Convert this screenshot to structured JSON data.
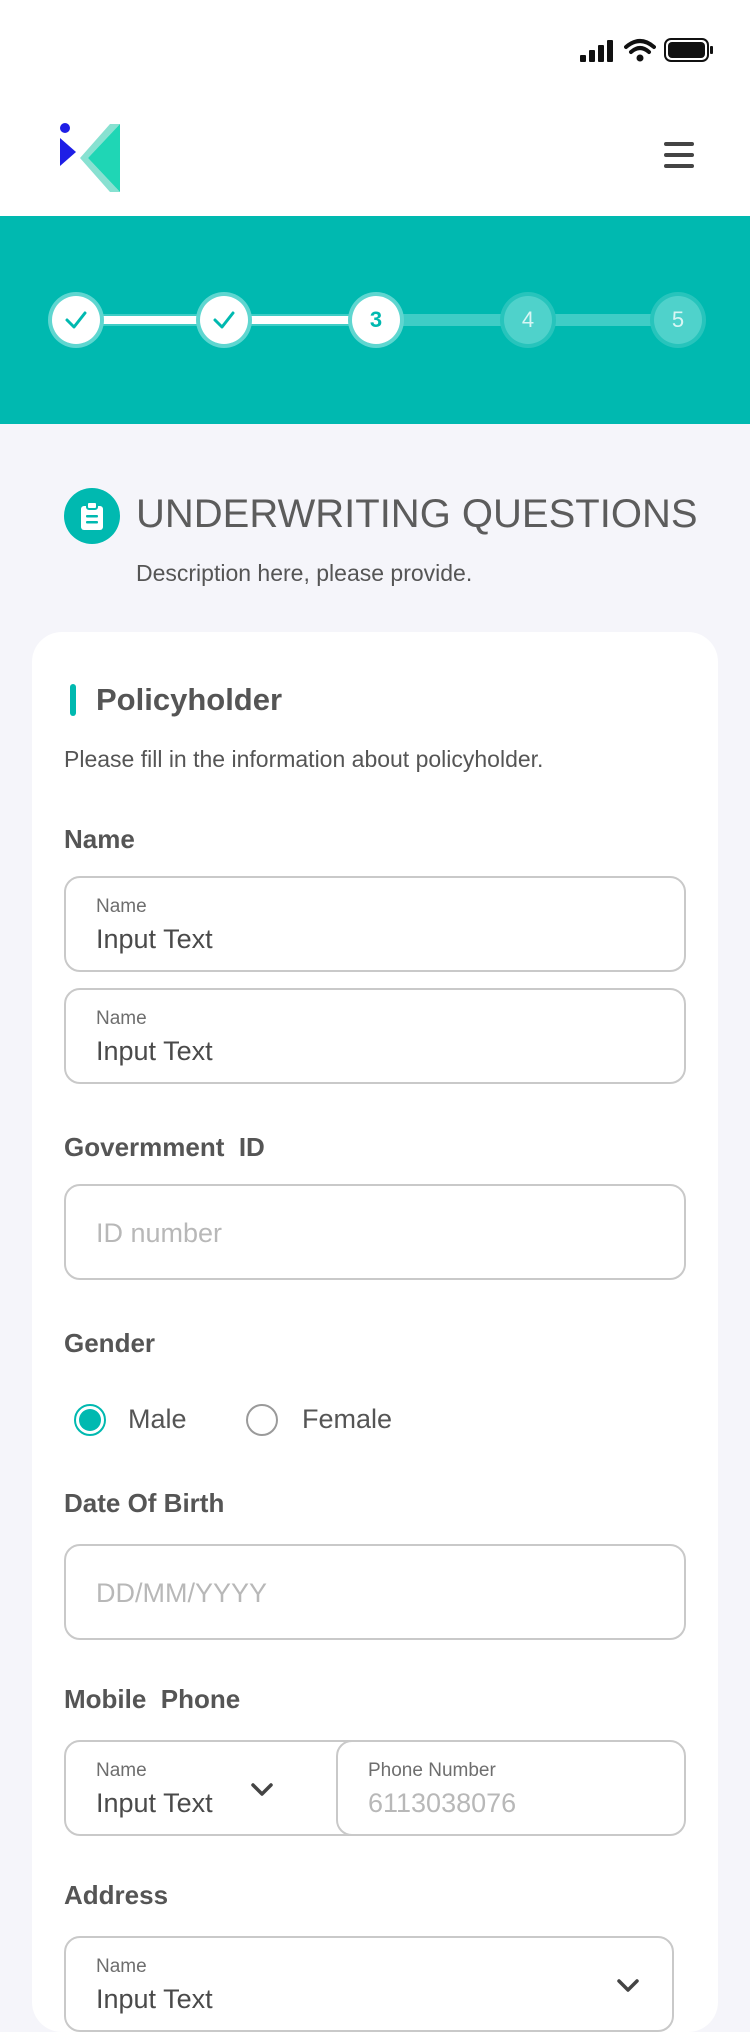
{
  "stepper": {
    "steps": [
      "1",
      "2",
      "3",
      "4",
      "5"
    ],
    "current_step": 3,
    "completed_steps": 2
  },
  "page": {
    "title": "UNDERWRITING QUESTIONS",
    "description": "Description here, please provide."
  },
  "card": {
    "title": "Policyholder",
    "subtitle": "Please fill in the information about policyholder."
  },
  "fields": {
    "name_label": "Name",
    "name1_small_label": "Name",
    "name1_value": "Input Text",
    "name2_small_label": "Name",
    "name2_value": "Input Text",
    "gov_id_label": "Govermment  ID",
    "gov_id_placeholder": "ID number",
    "gender_label": "Gender",
    "gender_male": "Male",
    "gender_female": "Female",
    "gender_selected": "Male",
    "dob_label": "Date Of Birth",
    "dob_placeholder": "DD/MM/YYYY",
    "mobile_label": "Mobile  Phone",
    "code_small_label": "Name",
    "code_value": "Input Text",
    "phone_small_label": "Phone Number",
    "phone_placeholder": "6113038076",
    "address_label": "Address",
    "address_small_label": "Name",
    "address_value": "Input Text"
  },
  "colors": {
    "accent": "#00b9b0",
    "logo_blue": "#1e1ee6",
    "logo_teal": "#1fd6b5",
    "background": "#f5f5fa"
  },
  "icons": {
    "signal": "cellular-signal-icon",
    "wifi": "wifi-icon",
    "battery": "battery-icon",
    "menu": "hamburger-menu-icon",
    "clipboard": "clipboard-icon",
    "check": "check-icon",
    "chevron": "chevron-down-icon"
  }
}
